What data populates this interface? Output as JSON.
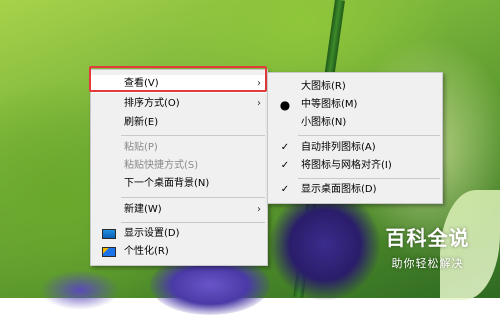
{
  "context_menu": {
    "items": [
      {
        "label": "查看(V)",
        "has_submenu": true,
        "highlighted": true
      },
      {
        "label": "排序方式(O)",
        "has_submenu": true
      },
      {
        "label": "刷新(E)"
      },
      {
        "label": "粘贴(P)",
        "disabled": true
      },
      {
        "label": "粘贴快捷方式(S)",
        "disabled": true
      },
      {
        "label": "下一个桌面背景(N)"
      },
      {
        "label": "新建(W)",
        "has_submenu": true
      },
      {
        "label": "显示设置(D)",
        "icon": "display-settings-icon"
      },
      {
        "label": "个性化(R)",
        "icon": "personalize-icon"
      }
    ]
  },
  "view_submenu": {
    "items": [
      {
        "label": "大图标(R)"
      },
      {
        "label": "中等图标(M)",
        "selected": true
      },
      {
        "label": "小图标(N)"
      },
      {
        "label": "自动排列图标(A)",
        "checked": true
      },
      {
        "label": "将图标与网格对齐(I)",
        "checked": true
      },
      {
        "label": "显示桌面图标(D)",
        "checked": true
      }
    ]
  },
  "glyphs": {
    "arrow": "›",
    "check": "✓",
    "dot": "●"
  },
  "watermark": {
    "title": "百科全说",
    "subtitle": "助你轻松解决"
  },
  "colors": {
    "highlight_border": "#e23b3b",
    "menu_bg": "#f0f0f0"
  }
}
